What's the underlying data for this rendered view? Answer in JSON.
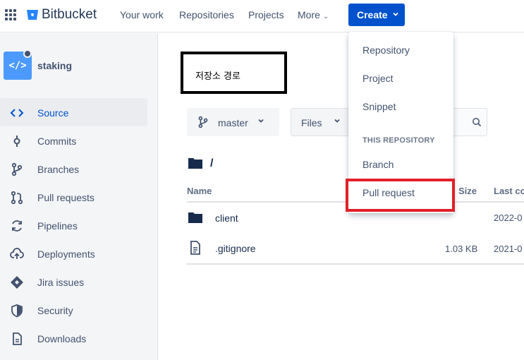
{
  "brand": {
    "name": "Bitbucket",
    "accent": "#0052cc"
  },
  "topnav": {
    "items": [
      "Your work",
      "Repositories",
      "Projects",
      "More"
    ],
    "create_label": "Create"
  },
  "sidebar": {
    "repo_name": "staking",
    "repo_avatar": "</>",
    "items": [
      {
        "label": "Source",
        "icon": "code-icon",
        "active": true
      },
      {
        "label": "Commits",
        "icon": "commit-icon"
      },
      {
        "label": "Branches",
        "icon": "branch-icon"
      },
      {
        "label": "Pull requests",
        "icon": "pull-request-icon"
      },
      {
        "label": "Pipelines",
        "icon": "pipelines-icon"
      },
      {
        "label": "Deployments",
        "icon": "cloud-upload-icon"
      },
      {
        "label": "Jira issues",
        "icon": "jira-icon"
      },
      {
        "label": "Security",
        "icon": "shield-icon"
      },
      {
        "label": "Downloads",
        "icon": "file-icon"
      }
    ]
  },
  "annotation": {
    "text": "저장소 경로"
  },
  "toolbar": {
    "branch": "master",
    "files": "Files"
  },
  "path": "/",
  "table": {
    "headers": {
      "name": "Name",
      "size": "Size",
      "last_commit": "Last co"
    },
    "rows": [
      {
        "name": "client",
        "type": "folder",
        "size": "",
        "date": "2022-0"
      },
      {
        "name": ".gitignore",
        "type": "file",
        "size": "1.03 KB",
        "date": "2021-0"
      }
    ]
  },
  "create_menu": {
    "items": [
      "Repository",
      "Project",
      "Snippet"
    ],
    "section_title": "THIS REPOSITORY",
    "repo_items": [
      "Branch",
      "Pull request"
    ],
    "highlight_color": "#e0202a"
  }
}
